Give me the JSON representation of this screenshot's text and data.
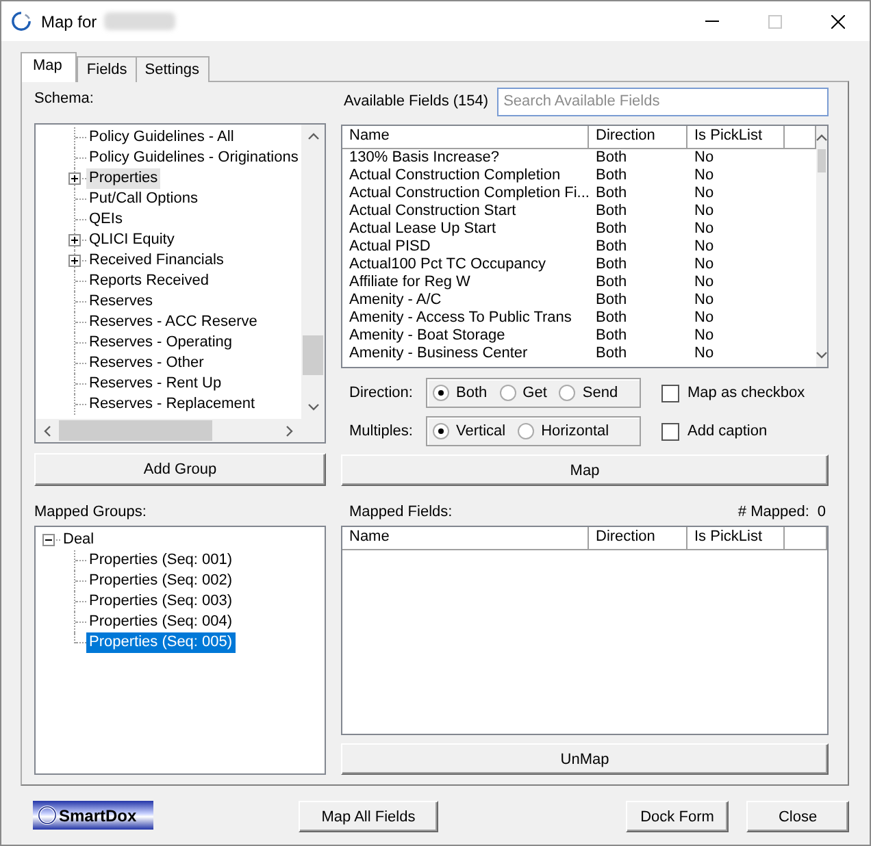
{
  "window": {
    "title": "Map for",
    "maximize_enabled": false
  },
  "tabs": [
    {
      "label": "Map",
      "selected": true
    },
    {
      "label": "Fields",
      "selected": false
    },
    {
      "label": "Settings",
      "selected": false
    }
  ],
  "schema": {
    "label": "Schema:",
    "items": [
      {
        "label": "Policy Guidelines - All",
        "expandable": false,
        "selected": false
      },
      {
        "label": "Policy Guidelines - Originations",
        "expandable": false,
        "selected": false
      },
      {
        "label": "Properties",
        "expandable": true,
        "selected": true
      },
      {
        "label": "Put/Call Options",
        "expandable": false,
        "selected": false
      },
      {
        "label": "QEIs",
        "expandable": false,
        "selected": false
      },
      {
        "label": "QLICI Equity",
        "expandable": true,
        "selected": false
      },
      {
        "label": "Received Financials",
        "expandable": true,
        "selected": false
      },
      {
        "label": "Reports Received",
        "expandable": false,
        "selected": false
      },
      {
        "label": "Reserves",
        "expandable": false,
        "selected": false
      },
      {
        "label": "Reserves - ACC Reserve",
        "expandable": false,
        "selected": false
      },
      {
        "label": "Reserves - Operating",
        "expandable": false,
        "selected": false
      },
      {
        "label": "Reserves - Other",
        "expandable": false,
        "selected": false
      },
      {
        "label": "Reserves - Rent Up",
        "expandable": false,
        "selected": false
      },
      {
        "label": "Reserves - Replacement",
        "expandable": false,
        "selected": false
      }
    ]
  },
  "add_group_button": "Add Group",
  "mapped_groups": {
    "label": "Mapped Groups:",
    "tree": [
      {
        "label": "Deal",
        "expanded": true,
        "selected": false,
        "children": [
          {
            "label": "Properties (Seq: 001)",
            "selected": false
          },
          {
            "label": "Properties (Seq: 002)",
            "selected": false
          },
          {
            "label": "Properties (Seq: 003)",
            "selected": false
          },
          {
            "label": "Properties (Seq: 004)",
            "selected": false
          },
          {
            "label": "Properties (Seq: 005)",
            "selected": true
          }
        ]
      }
    ]
  },
  "available_fields": {
    "label": "Available Fields (154)",
    "search": {
      "placeholder": "Search Available Fields"
    },
    "columns": [
      "Name",
      "Direction",
      "Is PickList"
    ],
    "rows": [
      {
        "name": "130% Basis Increase?",
        "direction": "Both",
        "is_picklist": "No"
      },
      {
        "name": "Actual Construction Completion",
        "direction": "Both",
        "is_picklist": "No"
      },
      {
        "name": "Actual Construction Completion Fi...",
        "direction": "Both",
        "is_picklist": "No"
      },
      {
        "name": "Actual Construction Start",
        "direction": "Both",
        "is_picklist": "No"
      },
      {
        "name": "Actual Lease Up Start",
        "direction": "Both",
        "is_picklist": "No"
      },
      {
        "name": "Actual PISD",
        "direction": "Both",
        "is_picklist": "No"
      },
      {
        "name": "Actual100 Pct TC Occupancy",
        "direction": "Both",
        "is_picklist": "No"
      },
      {
        "name": "Affiliate for Reg W",
        "direction": "Both",
        "is_picklist": "No"
      },
      {
        "name": "Amenity - A/C",
        "direction": "Both",
        "is_picklist": "No"
      },
      {
        "name": "Amenity - Access To Public Trans",
        "direction": "Both",
        "is_picklist": "No"
      },
      {
        "name": "Amenity - Boat Storage",
        "direction": "Both",
        "is_picklist": "No"
      },
      {
        "name": "Amenity - Business Center",
        "direction": "Both",
        "is_picklist": "No"
      }
    ]
  },
  "settings_rows": [
    {
      "label": "Direction:",
      "options": [
        {
          "label": "Both",
          "selected": true
        },
        {
          "label": "Get",
          "selected": false
        },
        {
          "label": "Send",
          "selected": false
        }
      ],
      "checkbox": {
        "label": "Map as checkbox",
        "checked": false
      }
    },
    {
      "label": "Multiples:",
      "options": [
        {
          "label": "Vertical",
          "selected": true
        },
        {
          "label": "Horizontal",
          "selected": false
        }
      ],
      "checkbox": {
        "label": "Add caption",
        "checked": false
      }
    }
  ],
  "map_button": "Map",
  "mapped_fields": {
    "label": "Mapped Fields:",
    "count_label": "# Mapped:",
    "count": "0",
    "columns": [
      "Name",
      "Direction",
      "Is PickList"
    ]
  },
  "unmap_button": "UnMap",
  "footer": {
    "logo": "SmartDox",
    "buttons": [
      "Map All Fields",
      "Dock Form",
      "Close"
    ]
  }
}
